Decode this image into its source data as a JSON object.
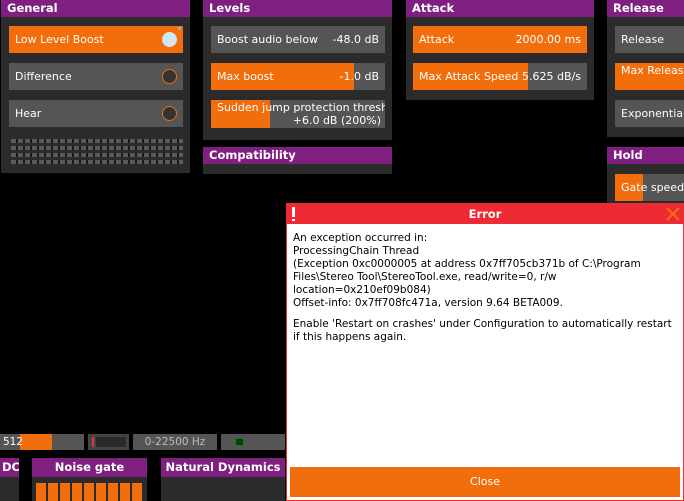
{
  "colors": {
    "accent": "#f26d0c",
    "header": "#7f1f7f",
    "panel": "#2b2b2b",
    "error": "#ee2a35"
  },
  "general": {
    "title": "General",
    "low_level_boost": "Low Level Boost",
    "difference": "Difference",
    "hear": "Hear"
  },
  "levels": {
    "title": "Levels",
    "boost_audio_below_label": "Boost audio below",
    "boost_audio_below_value": "-48.0 dB",
    "max_boost_label": "Max boost",
    "max_boost_value": "-1.0 dB",
    "max_boost_fraction": 0.82,
    "jump_label": "Sudden jump protection threshold",
    "jump_value": "+6.0 dB (200%)",
    "jump_fraction": 0.34
  },
  "compatibility": {
    "title": "Compatibility"
  },
  "attack": {
    "title": "Attack",
    "attack_label": "Attack",
    "attack_value": "2000.00 ms",
    "max_speed_label": "Max Attack Speed",
    "max_speed_value": "5.625 dB/s",
    "max_speed_fraction": 0.66
  },
  "release": {
    "title": "Release",
    "release_label": "Release",
    "max_release_label": "Max Release",
    "exponential_label": "Exponential R"
  },
  "hold": {
    "title": "Hold",
    "gate_speed_label": "Gate speed",
    "gate_speed_fraction": 0.4
  },
  "bottom": {
    "size_value": "512",
    "size_fraction": 0.5,
    "freq_range": "0-22500 Hz"
  },
  "lower_panels": {
    "dc": "DC",
    "noise_gate": "Noise gate",
    "natural_dynamics": "Natural Dynamics"
  },
  "dialog": {
    "title": "Error",
    "p1": "An exception occurred in:\nProcessingChain Thread\n(Exception 0xc0000005 at address 0x7ff705cb371b of C:\\Program Files\\Stereo Tool\\StereoTool.exe, read/write=0, r/w location=0x210ef09b084)\nOffset-info: 0x7ff708fc471a, version 9.64 BETA009.",
    "p2": "Enable 'Restart on crashes' under Configuration to automatically restart if this happens again.",
    "close": "Close"
  }
}
